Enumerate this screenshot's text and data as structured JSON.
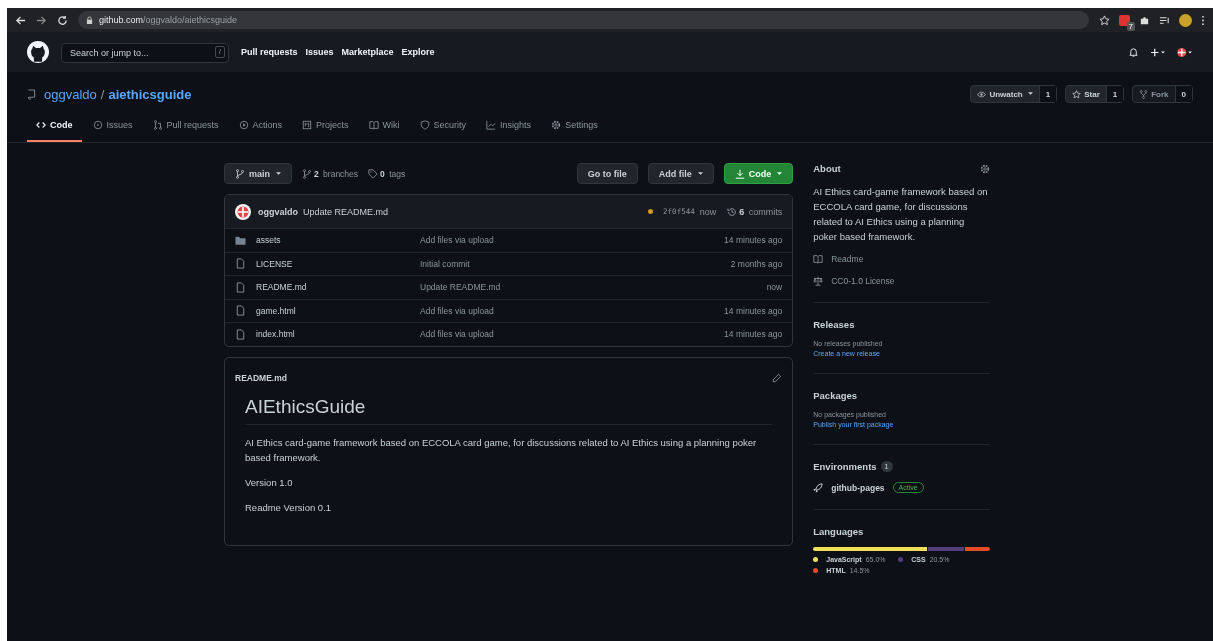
{
  "browser": {
    "url_host": "github.com",
    "url_path": "/oggvaldo/aiethicsguide",
    "extension_badge": "7"
  },
  "header": {
    "search": {
      "placeholder": "Search or jump to...",
      "shortcut": "/"
    },
    "nav": [
      "Pull requests",
      "Issues",
      "Marketplace",
      "Explore"
    ]
  },
  "repo": {
    "owner": "oggvaldo",
    "separator": "/",
    "name": "aiethicsguide",
    "actions": [
      {
        "kind": "watch",
        "label": "Unwatch",
        "count": "1",
        "disabled": false
      },
      {
        "kind": "star",
        "label": "Star",
        "count": "1",
        "disabled": false
      },
      {
        "kind": "fork",
        "label": "Fork",
        "count": "0",
        "disabled": true
      }
    ],
    "tabs": [
      {
        "kind": "code",
        "label": "Code",
        "selected": true
      },
      {
        "kind": "issues",
        "label": "Issues",
        "selected": false
      },
      {
        "kind": "pr",
        "label": "Pull requests",
        "selected": false
      },
      {
        "kind": "actions",
        "label": "Actions",
        "selected": false
      },
      {
        "kind": "projects",
        "label": "Projects",
        "selected": false
      },
      {
        "kind": "wiki",
        "label": "Wiki",
        "selected": false
      },
      {
        "kind": "security",
        "label": "Security",
        "selected": false
      },
      {
        "kind": "insights",
        "label": "Insights",
        "selected": false
      },
      {
        "kind": "settings",
        "label": "Settings",
        "selected": false
      }
    ]
  },
  "toolbar": {
    "branch": "main",
    "branches_count": "2",
    "branches_label": "branches",
    "tags_count": "0",
    "tags_label": "tags",
    "buttons": [
      {
        "kind": "plain",
        "label": "Go to file"
      },
      {
        "kind": "menu",
        "label": "Add file"
      },
      {
        "kind": "primary",
        "label": "Code"
      }
    ]
  },
  "commit": {
    "author": "oggvaldo",
    "message": "Update README.md",
    "hash": "2f0f544",
    "time": "now",
    "commits_count": "6",
    "commits_label": "commits"
  },
  "files": [
    {
      "kind": "folder",
      "name": "assets",
      "message": "Add files via upload",
      "time": "14 minutes ago"
    },
    {
      "kind": "file",
      "name": "LICENSE",
      "message": "Initial commit",
      "time": "2 months ago"
    },
    {
      "kind": "file",
      "name": "README.md",
      "message": "Update README.md",
      "time": "now"
    },
    {
      "kind": "file",
      "name": "game.html",
      "message": "Add files via upload",
      "time": "14 minutes ago"
    },
    {
      "kind": "file",
      "name": "index.html",
      "message": "Add files via upload",
      "time": "14 minutes ago"
    }
  ],
  "readme": {
    "filename": "README.md",
    "title": "AIEthicsGuide",
    "paragraphs": [
      "AI Ethics card-game framework based on ECCOLA card game, for discussions related to AI Ethics using a planning poker based framework.",
      "Version 1.0",
      "Readme Version 0.1"
    ]
  },
  "about": {
    "title": "About",
    "description": "AI Ethics card-game framework based on ECCOLA card game, for discussions related to AI Ethics using a planning poker based framework.",
    "links": [
      {
        "kind": "readme",
        "label": "Readme"
      },
      {
        "kind": "license",
        "label": "CC0-1.0 License"
      }
    ]
  },
  "releases": {
    "title": "Releases",
    "note": "No releases published",
    "link": "Create a new release"
  },
  "packages": {
    "title": "Packages",
    "note": "No packages published",
    "link": "Publish your first package"
  },
  "environments": {
    "title": "Environments",
    "count": "1",
    "items": [
      {
        "name": "github-pages",
        "status": "Active"
      }
    ]
  },
  "languages": {
    "title": "Languages",
    "items": [
      {
        "name": "JavaScript",
        "percent": "65.0%",
        "color": "#f1e05a"
      },
      {
        "name": "CSS",
        "percent": "20.5%",
        "color": "#563d7c"
      },
      {
        "name": "HTML",
        "percent": "14.5%",
        "color": "#e34c26"
      }
    ]
  }
}
